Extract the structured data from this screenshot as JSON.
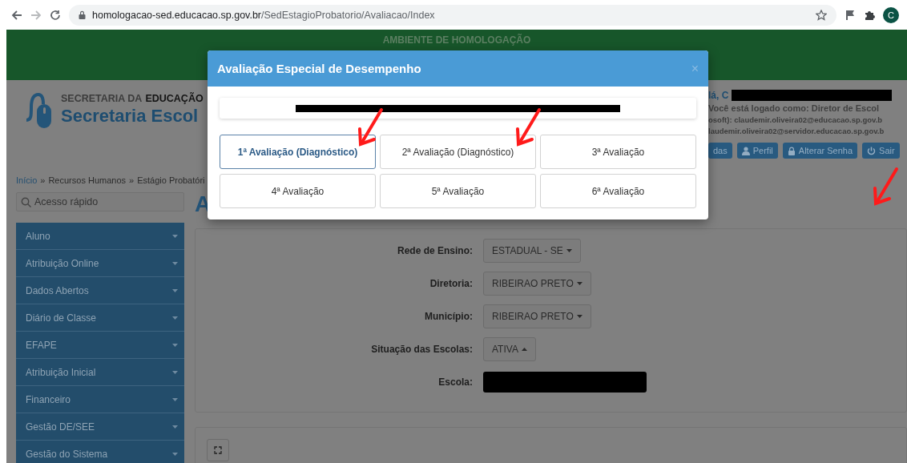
{
  "browser": {
    "url_host": "homologacao-sed.educacao.sp.gov.br",
    "url_path": "/SedEstagioProbatorio/Avaliacao/Index",
    "profile_initial": "C"
  },
  "banner": {
    "text": "AMBIENTE DE HOMOLOGAÇÃO"
  },
  "header": {
    "dept_prefix": "SECRETARIA DA",
    "dept_name": "EDUCAÇÃO",
    "app_name": "Secretaria Escol",
    "greeting": "lá, C",
    "logged_as": "Você está logado como: Diretor de Escol",
    "emails": [
      "osoft): claudemir.oliveira02@educacao.sp.gov.b",
      "laudemir.oliveira02@servidor.educacao.sp.gov.b"
    ],
    "buttons": [
      {
        "label": "das",
        "kind": "plain"
      },
      {
        "label": "Perfil",
        "kind": "user"
      },
      {
        "label": "Alterar Senha",
        "kind": "lock"
      },
      {
        "label": "Sair",
        "kind": "power"
      }
    ]
  },
  "breadcrumb": {
    "separator": "»",
    "items": [
      "Início",
      "Recursos Humanos",
      "Estágio Probatóri"
    ]
  },
  "search": {
    "placeholder": "Acesso rápido"
  },
  "sidebar": {
    "items": [
      "Aluno",
      "Atribuição Online",
      "Dados Abertos",
      "Diário de Classe",
      "EFAPE",
      "Atribuição Inicial",
      "Financeiro",
      "Gestão DE/SEE",
      "Gestão do Sistema"
    ]
  },
  "page_title": "A",
  "filters": [
    {
      "label": "Rede de Ensino:",
      "kind": "dropdown",
      "value": "ESTADUAL - SE",
      "expanded": false
    },
    {
      "label": "Diretoria:",
      "kind": "dropdown",
      "value": "RIBEIRAO PRETO",
      "expanded": false
    },
    {
      "label": "Município:",
      "kind": "dropdown",
      "value": "RIBEIRAO PRETO",
      "expanded": false
    },
    {
      "label": "Situação das Escolas:",
      "kind": "dropdown",
      "value": "ATIVA",
      "expanded": true
    },
    {
      "label": "Escola:",
      "kind": "redacted"
    }
  ],
  "modal": {
    "title": "Avaliação Especial de Desempenho",
    "close": "×",
    "buttons": [
      {
        "label": "1ª Avaliação (Diagnóstico)",
        "selected": true
      },
      {
        "label": "2ª Avaliação (Diagnóstico)",
        "selected": false
      },
      {
        "label": "3ª Avaliação",
        "selected": false
      },
      {
        "label": "4ª Avaliação",
        "selected": false
      },
      {
        "label": "5ª Avaliação",
        "selected": false
      },
      {
        "label": "6ª Avaliação",
        "selected": false
      }
    ]
  }
}
